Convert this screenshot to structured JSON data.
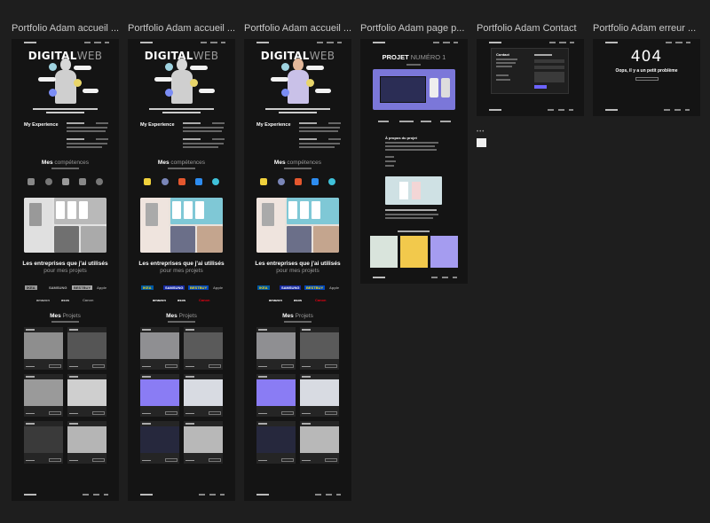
{
  "frames": [
    {
      "id": "home-bw",
      "label": "Portfolio Adam accueil ..."
    },
    {
      "id": "home-bw-2",
      "label": "Portfolio Adam accueil ..."
    },
    {
      "id": "home-color",
      "label": "Portfolio Adam accueil ..."
    },
    {
      "id": "project",
      "label": "Portfolio Adam page p..."
    },
    {
      "id": "contact",
      "label": "Portfolio Adam Contact"
    },
    {
      "id": "error",
      "label": "Portfolio Adam erreur ..."
    }
  ],
  "home": {
    "hero_title_a": "DIGITAL",
    "hero_title_b": "WEB",
    "experience_title": "My Experience",
    "skills_title_a": "Mes",
    "skills_title_b": "compétences",
    "companies_title": "Les entreprises que j'ai utilisés",
    "companies_sub": "pour mes projets",
    "projects_title_a": "Mes",
    "projects_title_b": "Projets",
    "logos": [
      "IKEA",
      "SAMSUNG",
      "BESTBUY",
      "Apple",
      "amazon",
      "asos",
      "Canon"
    ]
  },
  "project_page": {
    "title_a": "PROJET",
    "title_b": "NUMÉRO 1",
    "about": "À propos du projet"
  },
  "contact_page": {
    "title": "Contact"
  },
  "error_page": {
    "code": "404",
    "message": "Oops, il y a un petit problème"
  },
  "colors": {
    "canvas": "#1e1e1e",
    "frame_bg": "#141414",
    "accent_purple": "#6c63ff",
    "accent_blue": "#2d8cf0"
  }
}
